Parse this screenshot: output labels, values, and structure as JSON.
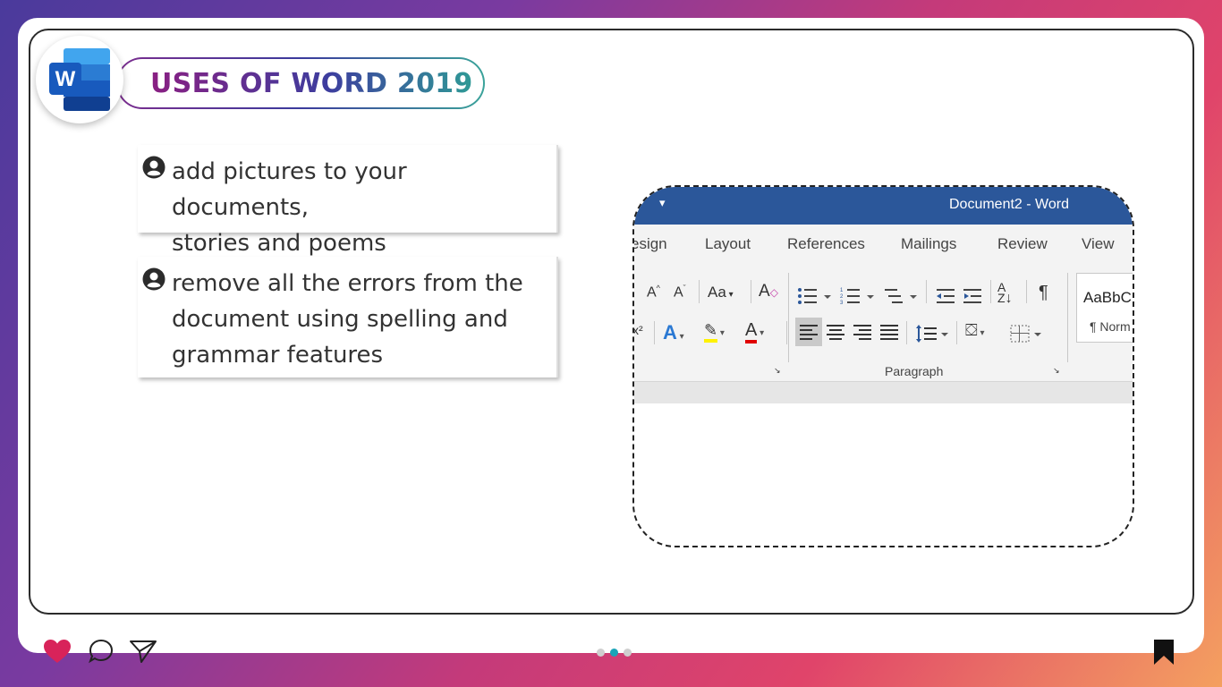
{
  "header": {
    "title": "USES OF WORD 2019",
    "logo_letter": "W"
  },
  "bullets": [
    {
      "lines": [
        "add pictures to your documents,",
        "stories and poems"
      ]
    },
    {
      "lines": [
        "remove all the errors from the",
        "document using spelling and",
        "grammar features"
      ]
    }
  ],
  "word_window": {
    "document_title": "Document2  -  Word",
    "tabs": [
      "esign",
      "Layout",
      "References",
      "Mailings",
      "Review",
      "View"
    ],
    "group_label": "Paragraph",
    "style_preview": "AaBbC",
    "style_name": "¶ Norm",
    "change_case_label": "Aa"
  },
  "footer": {
    "dots_total": 3,
    "active_dot": 1
  },
  "colors": {
    "heart": "#d8235a",
    "word_blue": "#2b579a",
    "dot_active": "#1aa3b8"
  }
}
